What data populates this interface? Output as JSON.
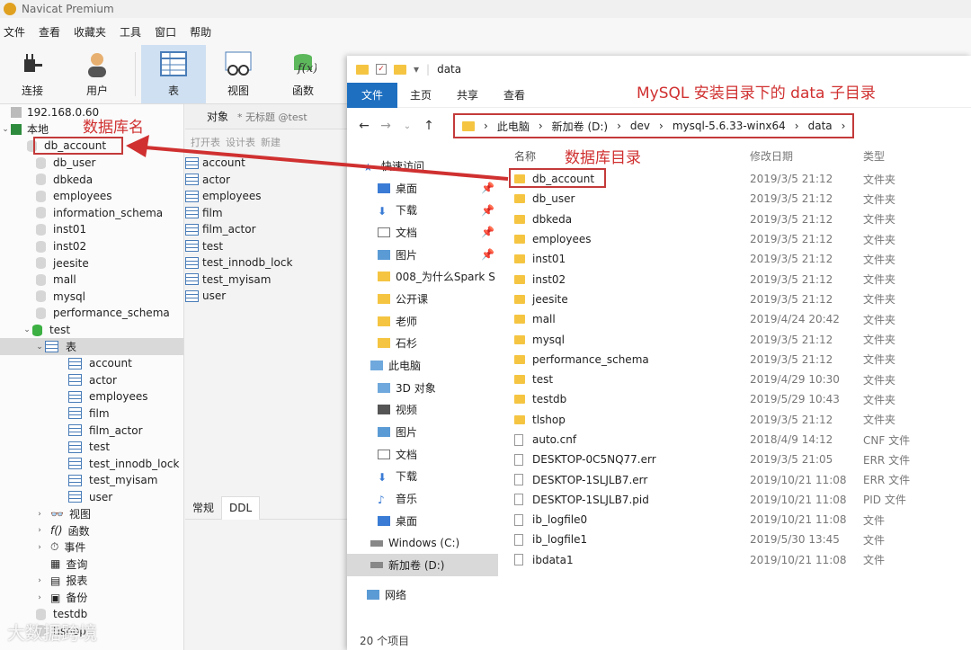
{
  "navicat": {
    "title": "Navicat Premium",
    "menu": [
      "文件",
      "查看",
      "收藏夹",
      "工具",
      "窗口",
      "帮助"
    ],
    "toolbar": [
      "连接",
      "用户",
      "表",
      "视图",
      "函数"
    ],
    "sidebar": {
      "ip": "192.168.0.60",
      "local": "本地",
      "databases": [
        "db_account",
        "db_user",
        "dbkeda",
        "employees",
        "information_schema",
        "inst01",
        "inst02",
        "jeesite",
        "mall",
        "mysql",
        "performance_schema"
      ],
      "test_db": "test",
      "tables_label": "表",
      "tables": [
        "account",
        "actor",
        "employees",
        "film",
        "film_actor",
        "test",
        "test_innodb_lock",
        "test_myisam",
        "user"
      ],
      "groups": [
        "视图",
        "函数",
        "事件",
        "查询",
        "报表",
        "备份"
      ],
      "after": [
        "testdb",
        "tlshop"
      ]
    },
    "objects": {
      "tab": "对象",
      "untitled": "* 无标题 @test",
      "tools": [
        "打开表",
        "设计表",
        "新建"
      ],
      "list": [
        "account",
        "actor",
        "employees",
        "film",
        "film_actor",
        "test",
        "test_innodb_lock",
        "test_myisam",
        "user"
      ]
    },
    "bottom_tabs": [
      "常规",
      "DDL"
    ]
  },
  "explorer": {
    "title": "data",
    "ribbon": [
      "文件",
      "主页",
      "共享",
      "查看"
    ],
    "breadcrumbs": [
      "此电脑",
      "新加卷 (D:)",
      "dev",
      "mysql-5.6.33-winx64",
      "data"
    ],
    "nav": [
      "快速访问",
      "桌面",
      "下载",
      "文档",
      "图片",
      "008_为什么Spark S",
      "公开课",
      "老师",
      "石杉",
      "此电脑",
      "3D 对象",
      "视频",
      "图片",
      "文档",
      "下载",
      "音乐",
      "桌面",
      "Windows (C:)",
      "新加卷 (D:)",
      "网络"
    ],
    "columns": [
      "名称",
      "修改日期",
      "类型"
    ],
    "files": [
      {
        "name": "db_account",
        "date": "2019/3/5 21:12",
        "type": "文件夹",
        "folder": true
      },
      {
        "name": "db_user",
        "date": "2019/3/5 21:12",
        "type": "文件夹",
        "folder": true
      },
      {
        "name": "dbkeda",
        "date": "2019/3/5 21:12",
        "type": "文件夹",
        "folder": true
      },
      {
        "name": "employees",
        "date": "2019/3/5 21:12",
        "type": "文件夹",
        "folder": true
      },
      {
        "name": "inst01",
        "date": "2019/3/5 21:12",
        "type": "文件夹",
        "folder": true
      },
      {
        "name": "inst02",
        "date": "2019/3/5 21:12",
        "type": "文件夹",
        "folder": true
      },
      {
        "name": "jeesite",
        "date": "2019/3/5 21:12",
        "type": "文件夹",
        "folder": true
      },
      {
        "name": "mall",
        "date": "2019/4/24 20:42",
        "type": "文件夹",
        "folder": true
      },
      {
        "name": "mysql",
        "date": "2019/3/5 21:12",
        "type": "文件夹",
        "folder": true
      },
      {
        "name": "performance_schema",
        "date": "2019/3/5 21:12",
        "type": "文件夹",
        "folder": true
      },
      {
        "name": "test",
        "date": "2019/4/29 10:30",
        "type": "文件夹",
        "folder": true
      },
      {
        "name": "testdb",
        "date": "2019/5/29 10:43",
        "type": "文件夹",
        "folder": true
      },
      {
        "name": "tlshop",
        "date": "2019/3/5 21:12",
        "type": "文件夹",
        "folder": true
      },
      {
        "name": "auto.cnf",
        "date": "2018/4/9 14:12",
        "type": "CNF 文件",
        "folder": false
      },
      {
        "name": "DESKTOP-0C5NQ77.err",
        "date": "2019/3/5 21:05",
        "type": "ERR 文件",
        "folder": false
      },
      {
        "name": "DESKTOP-1SLJLB7.err",
        "date": "2019/10/21 11:08",
        "type": "ERR 文件",
        "folder": false
      },
      {
        "name": "DESKTOP-1SLJLB7.pid",
        "date": "2019/10/21 11:08",
        "type": "PID 文件",
        "folder": false
      },
      {
        "name": "ib_logfile0",
        "date": "2019/10/21 11:08",
        "type": "文件",
        "folder": false
      },
      {
        "name": "ib_logfile1",
        "date": "2019/5/30 13:45",
        "type": "文件",
        "folder": false
      },
      {
        "name": "ibdata1",
        "date": "2019/10/21 11:08",
        "type": "文件",
        "folder": false
      }
    ],
    "status": "20 个项目"
  },
  "annotations": {
    "db_name": "数据库名",
    "install_dir": "MySQL 安装目录下的 data 子目录",
    "db_dir": "数据库目录",
    "color": "#d03030"
  },
  "watermark": "大数据跨境"
}
